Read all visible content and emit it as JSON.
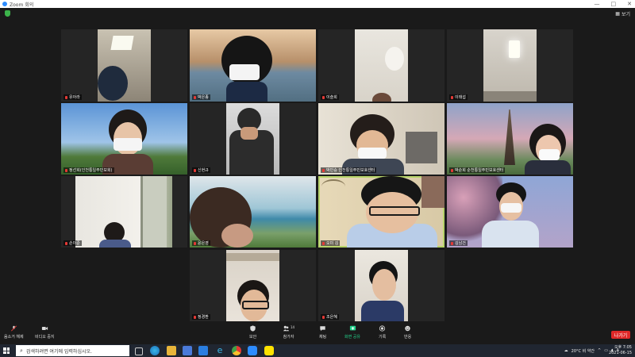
{
  "window": {
    "title": "Zoom 회의",
    "controls": [
      "—",
      "□",
      "✕"
    ]
  },
  "topbar": {
    "view_label": "보기"
  },
  "participants": [
    {
      "name": "유아라"
    },
    {
      "name": "박은종"
    },
    {
      "name": "이슬희"
    },
    {
      "name": "이태섭"
    },
    {
      "name": "정선희(인천통일주민보회)"
    },
    {
      "name": "신현규"
    },
    {
      "name": "박민승 인천통일주민보호센터"
    },
    {
      "name": "박순희 순천통일주민보호센터"
    },
    {
      "name": "손이준"
    },
    {
      "name": "윤은영"
    },
    {
      "name": "오미 김"
    },
    {
      "name": "김남건"
    },
    {
      "name": "정경환"
    },
    {
      "name": "조은혜"
    }
  ],
  "toolbar": {
    "audio": "음소거 해제",
    "video": "비디오 중지",
    "security": "보안",
    "participants": "참가자",
    "participants_count": "14",
    "chat": "채팅",
    "share": "화면 공유",
    "record": "기록",
    "reactions": "반응",
    "leave": "나가기"
  },
  "taskbar": {
    "search_placeholder": "검색하려면 여기에 입력하십시오.",
    "weather": "20°C 비 약간",
    "ime": "A",
    "time": "오후 7:05",
    "date": "2021-06-15"
  },
  "colors": {
    "accent_green": "#b7d46a",
    "leave_red": "#e02828",
    "share_green": "#23d18b",
    "mic_red": "#e53935"
  }
}
